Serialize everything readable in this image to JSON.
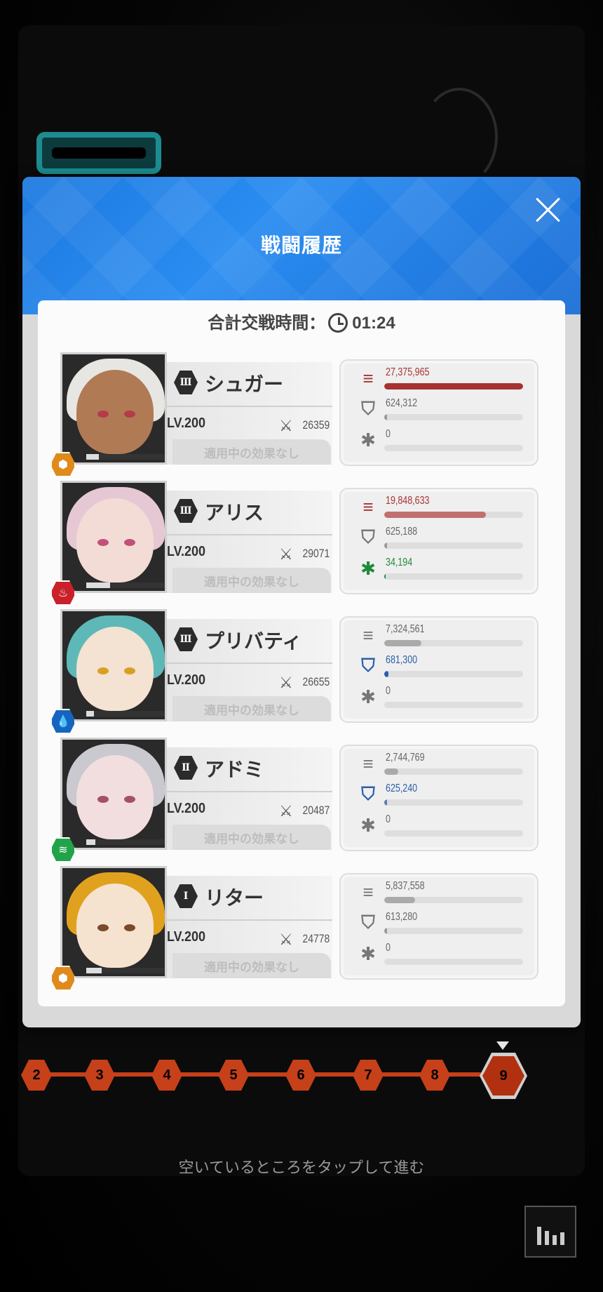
{
  "dialog": {
    "title": "戦闘履歴",
    "total_label": "合計交戦時間：",
    "total_time": "01:24"
  },
  "colors": {
    "header_blue": "#1e7ae0",
    "damage_red": "#a83232",
    "shield_blue": "#2a5fa8",
    "heal_green": "#1f8a3a",
    "stage_orange": "#c6401a"
  },
  "characters": [
    {
      "burst": "Ⅲ",
      "name": "シュガー",
      "level": "LV.200",
      "power": "26359",
      "effect": "適用中の効果なし",
      "element_icon": "iron-hex-icon",
      "damage": "27,375,965",
      "damage_fraction": 1.0,
      "damage_taken": "624,312",
      "damage_taken_fraction": 0.02,
      "heal": "0",
      "heal_fraction": 0
    },
    {
      "burst": "Ⅲ",
      "name": "アリス",
      "level": "LV.200",
      "power": "29071",
      "effect": "適用中の効果なし",
      "element_icon": "fire-hex-icon",
      "damage": "19,848,633",
      "damage_fraction": 0.73,
      "damage_taken": "625,188",
      "damage_taken_fraction": 0.02,
      "heal": "34,194",
      "heal_fraction": 0.01
    },
    {
      "burst": "Ⅲ",
      "name": "プリバティ",
      "level": "LV.200",
      "power": "26655",
      "effect": "適用中の効果なし",
      "element_icon": "water-hex-icon",
      "damage": "7,324,561",
      "damage_fraction": 0.27,
      "damage_taken": "681,300",
      "damage_taken_fraction": 0.03,
      "heal": "0",
      "heal_fraction": 0
    },
    {
      "burst": "Ⅱ",
      "name": "アドミ",
      "level": "LV.200",
      "power": "20487",
      "effect": "適用中の効果なし",
      "element_icon": "wind-hex-icon",
      "damage": "2,744,769",
      "damage_fraction": 0.1,
      "damage_taken": "625,240",
      "damage_taken_fraction": 0.02,
      "heal": "0",
      "heal_fraction": 0
    },
    {
      "burst": "Ⅰ",
      "name": "リター",
      "level": "LV.200",
      "power": "24778",
      "effect": "適用中の効果なし",
      "element_icon": "iron-hex-icon",
      "damage": "5,837,558",
      "damage_fraction": 0.22,
      "damage_taken": "613,280",
      "damage_taken_fraction": 0.02,
      "heal": "0",
      "heal_fraction": 0
    }
  ],
  "stages": [
    "2",
    "3",
    "4",
    "5",
    "6",
    "7",
    "8",
    "9"
  ],
  "current_stage": "9",
  "hint": "空いているところをタップして進む"
}
